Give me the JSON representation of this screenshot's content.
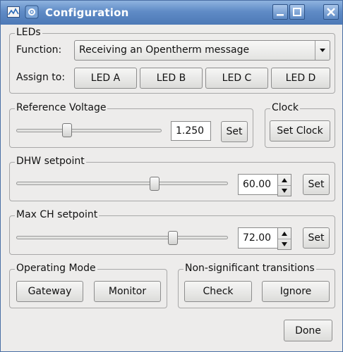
{
  "window": {
    "title": "Configuration"
  },
  "leds": {
    "legend": "LEDs",
    "function_label": "Function:",
    "function_value": "Receiving an Opentherm message",
    "assign_label": "Assign to:",
    "buttons": [
      "LED A",
      "LED B",
      "LED C",
      "LED D"
    ]
  },
  "reference_voltage": {
    "legend": "Reference Voltage",
    "value": "1.250",
    "set_label": "Set",
    "slider_fraction": 0.34
  },
  "clock": {
    "legend": "Clock",
    "button": "Set Clock"
  },
  "dhw": {
    "legend": "DHW setpoint",
    "value": "60.00",
    "set_label": "Set",
    "slider_fraction": 0.66
  },
  "max_ch": {
    "legend": "Max CH setpoint",
    "value": "72.00",
    "set_label": "Set",
    "slider_fraction": 0.75
  },
  "operating_mode": {
    "legend": "Operating Mode",
    "gateway": "Gateway",
    "monitor": "Monitor"
  },
  "transitions": {
    "legend": "Non-significant transitions",
    "check": "Check",
    "ignore": "Ignore"
  },
  "done_label": "Done",
  "icons": {
    "app": "app-icon",
    "menu": "window-menu-icon",
    "minimize": "minimize-icon",
    "maximize": "maximize-icon",
    "close": "close-icon",
    "combo_arrow": "chevron-down-icon"
  },
  "colors": {
    "titlebar": "#5f8bc6",
    "window_bg": "#edeceb"
  }
}
